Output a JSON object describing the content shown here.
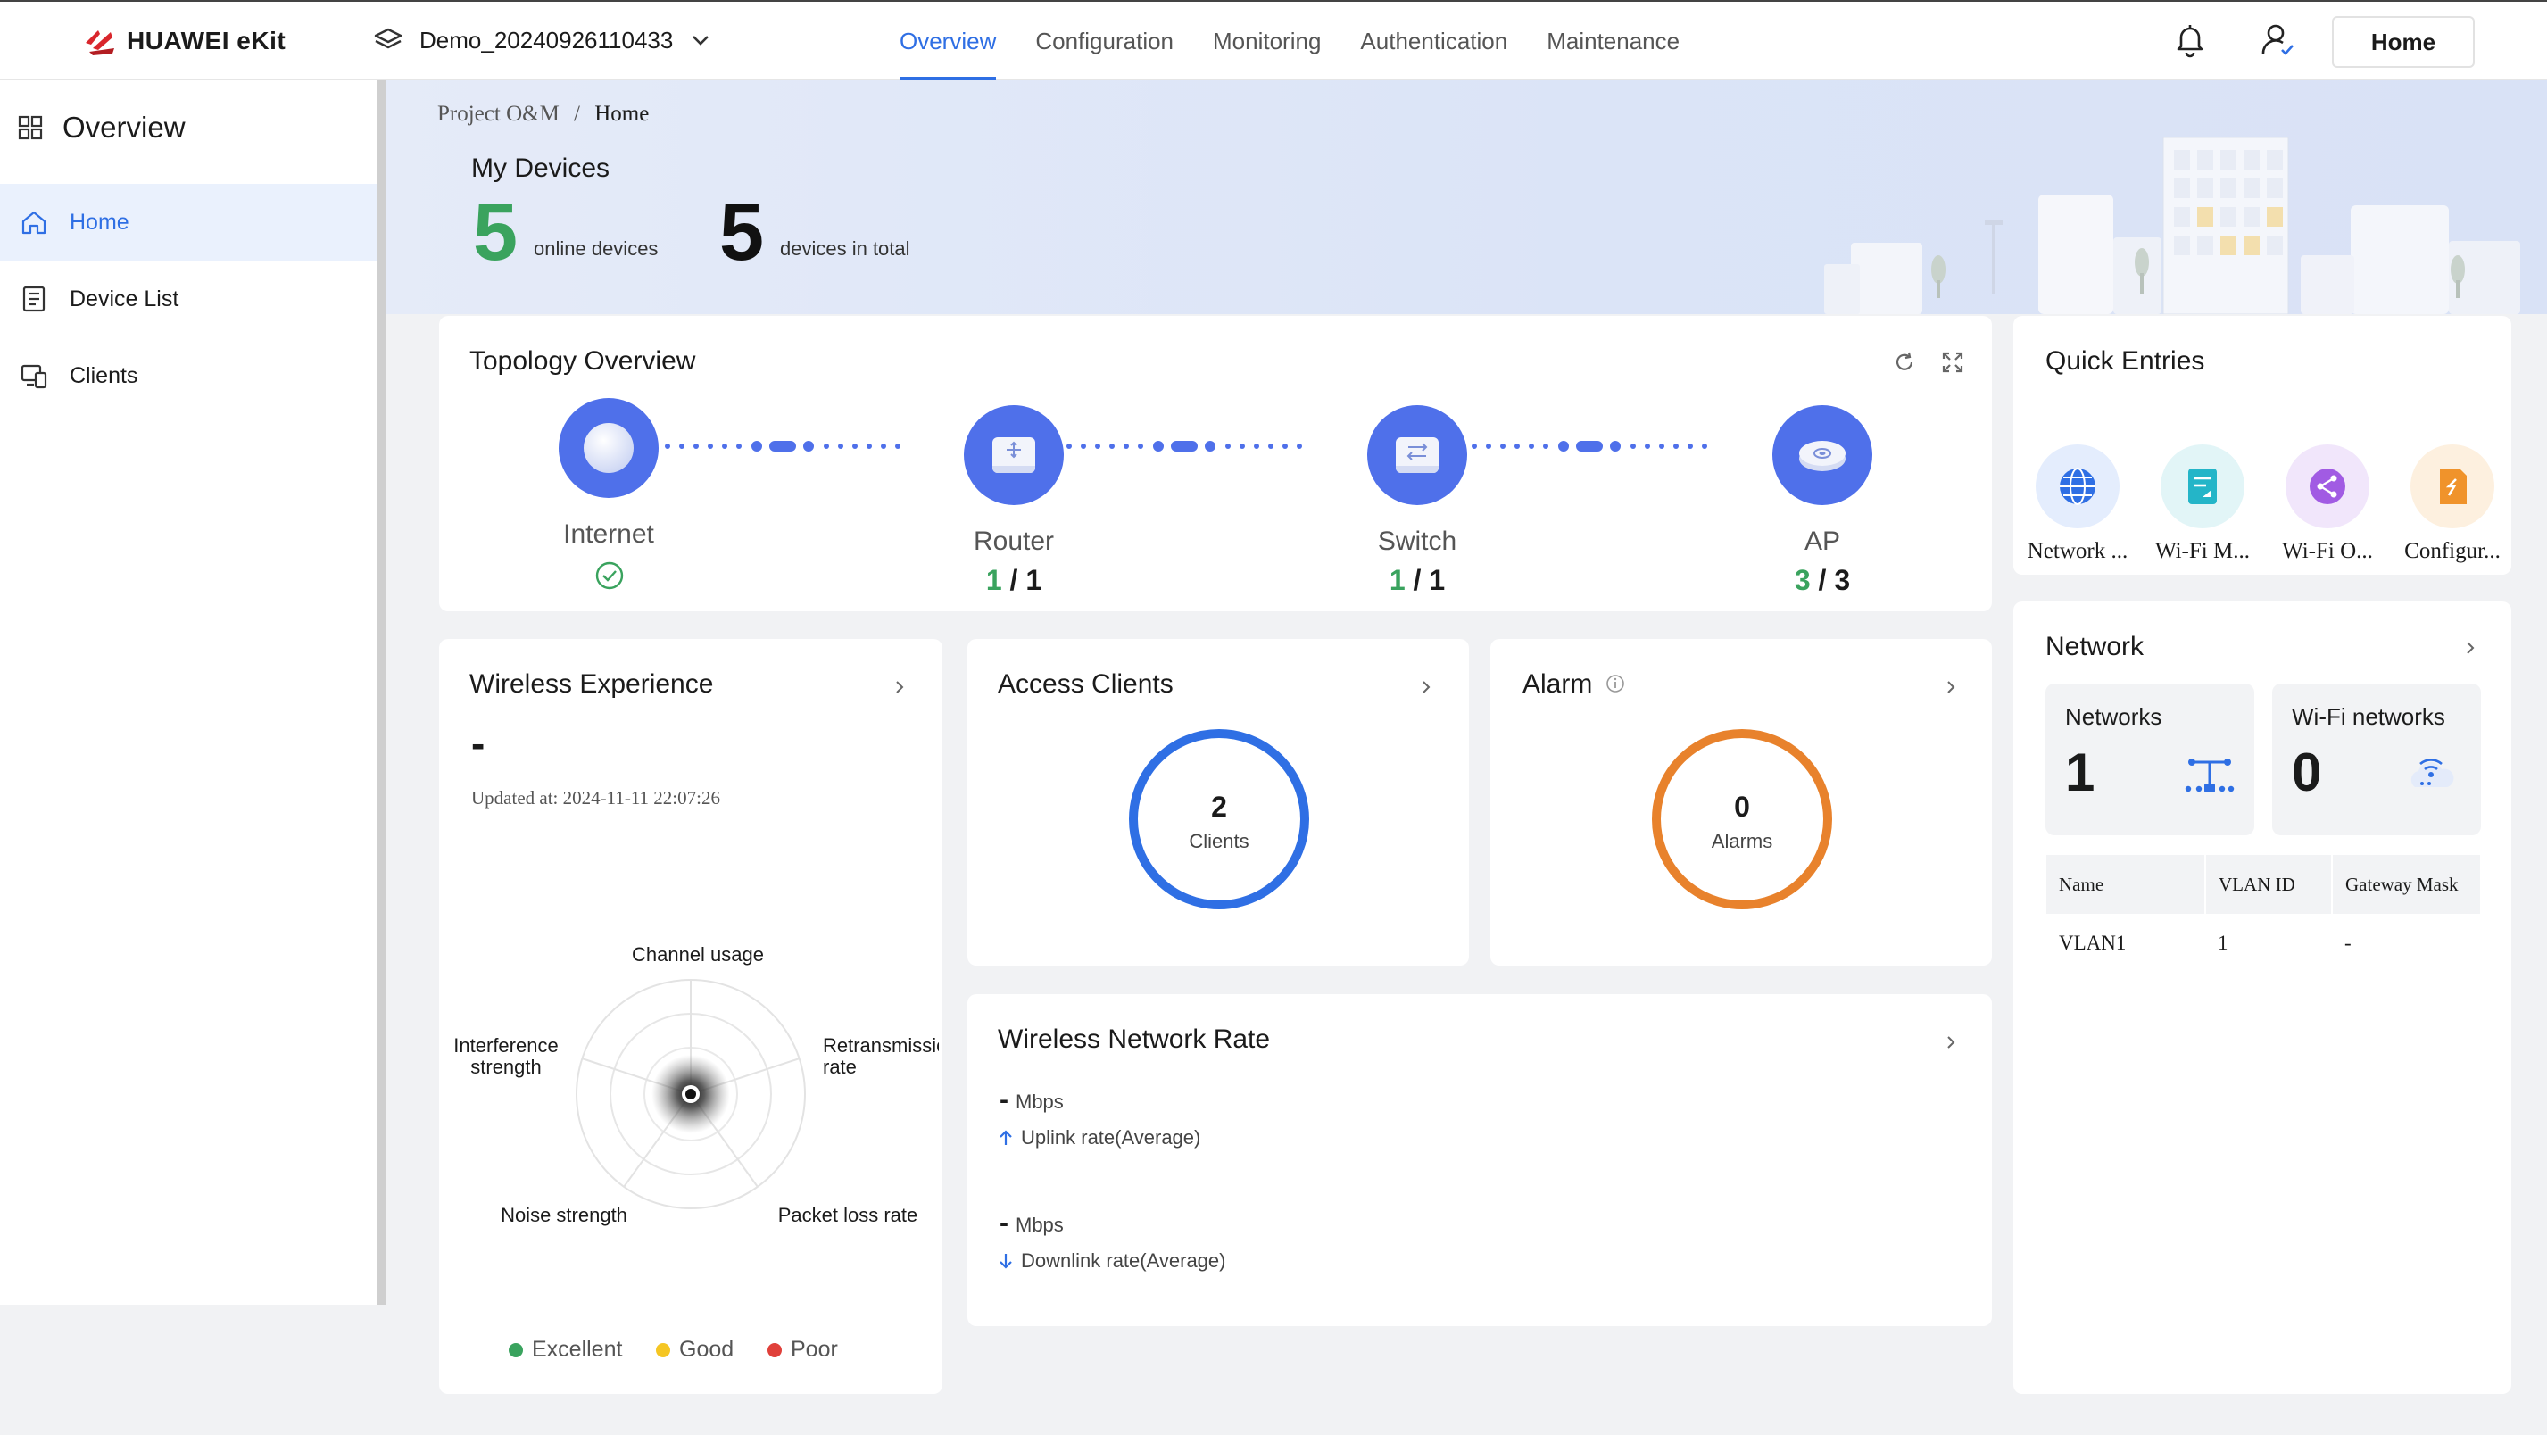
{
  "topbar": {
    "brand": "HUAWEI eKit",
    "project": "Demo_20240926110433",
    "nav": [
      "Overview",
      "Configuration",
      "Monitoring",
      "Authentication",
      "Maintenance"
    ],
    "active_nav": "Overview",
    "home_button": "Home",
    "icons": [
      "bell-icon",
      "user-icon"
    ]
  },
  "sidebar": {
    "title": "Overview",
    "items": [
      {
        "label": "Home",
        "icon": "home-icon",
        "active": true
      },
      {
        "label": "Device List",
        "icon": "device-list-icon",
        "active": false
      },
      {
        "label": "Clients",
        "icon": "clients-icon",
        "active": false
      }
    ]
  },
  "breadcrumb": {
    "parent": "Project O&M",
    "separator": "/",
    "current": "Home"
  },
  "my_devices": {
    "title": "My Devices",
    "online": "5",
    "online_label": "online devices",
    "total": "5",
    "total_label": "devices in total"
  },
  "topology": {
    "title": "Topology Overview",
    "nodes": [
      {
        "label": "Internet",
        "status": "ok"
      },
      {
        "label": "Router",
        "online": "1",
        "total": "1"
      },
      {
        "label": "Switch",
        "online": "1",
        "total": "1"
      },
      {
        "label": "AP",
        "online": "3",
        "total": "3"
      }
    ],
    "separator": "/"
  },
  "quick_entries": {
    "title": "Quick Entries",
    "items": [
      {
        "label": "Network ...",
        "icon": "globe-icon",
        "color": "#2f6fe4"
      },
      {
        "label": "Wi-Fi M...",
        "icon": "wifi-doc-icon",
        "color": "#24b5c8"
      },
      {
        "label": "Wi-Fi O...",
        "icon": "share-icon",
        "color": "#a15be3"
      },
      {
        "label": "Configur...",
        "icon": "config-doc-icon",
        "color": "#f0932b"
      }
    ]
  },
  "wireless_experience": {
    "title": "Wireless Experience",
    "value": "-",
    "updated": "Updated at: 2024-11-11 22:07:26",
    "radar_labels": {
      "top": "Channel usage",
      "left_1": "Interference",
      "left_2": "strength",
      "right_1": "Retransmissio",
      "right_2": "rate",
      "bottom_left": "Noise strength",
      "bottom_right": "Packet loss rate"
    },
    "legend": [
      {
        "label": "Excellent",
        "color": "#3aa35e"
      },
      {
        "label": "Good",
        "color": "#f5c623"
      },
      {
        "label": "Poor",
        "color": "#e0403a"
      }
    ]
  },
  "access_clients": {
    "title": "Access Clients",
    "value": "2",
    "label": "Clients",
    "color": "#2f6fe4"
  },
  "alarm": {
    "title": "Alarm",
    "value": "0",
    "label": "Alarms",
    "color": "#e8822c"
  },
  "wireless_rate": {
    "title": "Wireless Network Rate",
    "uplink_value": "-",
    "uplink_unit": "Mbps",
    "uplink_label": "Uplink rate(Average)",
    "downlink_value": "-",
    "downlink_unit": "Mbps",
    "downlink_label": "Downlink rate(Average)"
  },
  "network": {
    "title": "Network",
    "networks_label": "Networks",
    "networks_count": "1",
    "wifi_label": "Wi-Fi networks",
    "wifi_count": "0",
    "table": {
      "headers": [
        "Name",
        "VLAN ID",
        "Gateway Mask"
      ],
      "rows": [
        [
          "VLAN1",
          "1",
          "-"
        ]
      ]
    }
  }
}
